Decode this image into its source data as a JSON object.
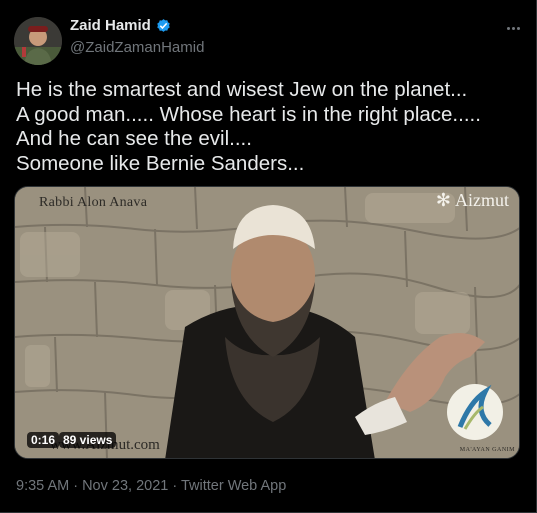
{
  "tweet": {
    "display_name": "Zaid Hamid",
    "handle": "@ZaidZamanHamid",
    "verified": true,
    "text_lines": [
      "He is the smartest and wisest Jew on the planet...",
      "A good man..... Whose heart is in the right place.....",
      "And he can see the evil....",
      "Someone like Bernie Sanders..."
    ],
    "timestamp": "9:35 AM · Nov 23, 2021 · Twitter Web App"
  },
  "video": {
    "watermark_title": "Rabbi Alon Anava",
    "watermark_brand": "Aizmut",
    "watermark_url": "www.Aizmut.com",
    "logo_caption": "MA'AYAN GANIM",
    "duration": "0:16",
    "views": "89 views"
  },
  "colors": {
    "background": "#000000",
    "text_primary": "#e7e9ea",
    "text_secondary": "#71767b",
    "verified": "#1d9bf0"
  },
  "icons": [
    "avatar",
    "verified-badge-icon",
    "more-options-icon",
    "play-video"
  ]
}
